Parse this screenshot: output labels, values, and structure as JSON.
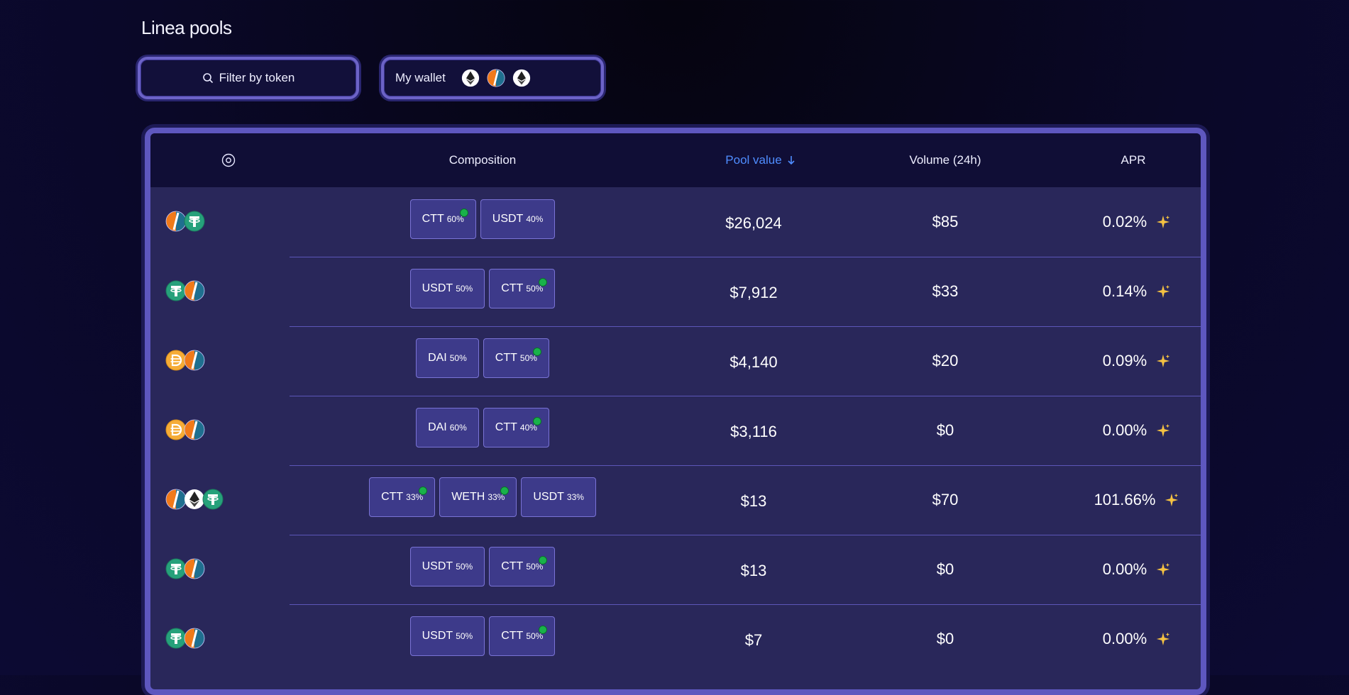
{
  "page": {
    "title": "Linea pools"
  },
  "controls": {
    "filter_label": "Filter by token",
    "wallet_label": "My wallet",
    "wallet_tokens": [
      "eth-icon",
      "ctt-icon",
      "eth-icon"
    ]
  },
  "table": {
    "columns": {
      "composition": "Composition",
      "pool_value": "Pool value",
      "volume": "Volume (24h)",
      "apr": "APR"
    },
    "rows": [
      {
        "icons": [
          "ctt",
          "usdt"
        ],
        "chips": [
          {
            "sym": "CTT",
            "pct": "60%",
            "dot": true
          },
          {
            "sym": "USDT",
            "pct": "40%",
            "dot": false
          }
        ],
        "value": "$26,024",
        "volume": "$85",
        "apr": "0.02%"
      },
      {
        "icons": [
          "usdt",
          "ctt"
        ],
        "chips": [
          {
            "sym": "USDT",
            "pct": "50%",
            "dot": false
          },
          {
            "sym": "CTT",
            "pct": "50%",
            "dot": true
          }
        ],
        "value": "$7,912",
        "volume": "$33",
        "apr": "0.14%"
      },
      {
        "icons": [
          "dai",
          "ctt"
        ],
        "chips": [
          {
            "sym": "DAI",
            "pct": "50%",
            "dot": false
          },
          {
            "sym": "CTT",
            "pct": "50%",
            "dot": true
          }
        ],
        "value": "$4,140",
        "volume": "$20",
        "apr": "0.09%"
      },
      {
        "icons": [
          "dai",
          "ctt"
        ],
        "chips": [
          {
            "sym": "DAI",
            "pct": "60%",
            "dot": false
          },
          {
            "sym": "CTT",
            "pct": "40%",
            "dot": true
          }
        ],
        "value": "$3,116",
        "volume": "$0",
        "apr": "0.00%"
      },
      {
        "icons": [
          "ctt",
          "eth",
          "usdt"
        ],
        "chips": [
          {
            "sym": "CTT",
            "pct": "33%",
            "dot": true
          },
          {
            "sym": "WETH",
            "pct": "33%",
            "dot": true
          },
          {
            "sym": "USDT",
            "pct": "33%",
            "dot": false
          }
        ],
        "value": "$13",
        "volume": "$70",
        "apr": "101.66%"
      },
      {
        "icons": [
          "usdt",
          "ctt"
        ],
        "chips": [
          {
            "sym": "USDT",
            "pct": "50%",
            "dot": false
          },
          {
            "sym": "CTT",
            "pct": "50%",
            "dot": true
          }
        ],
        "value": "$13",
        "volume": "$0",
        "apr": "0.00%"
      },
      {
        "icons": [
          "usdt",
          "ctt"
        ],
        "chips": [
          {
            "sym": "USDT",
            "pct": "50%",
            "dot": false
          },
          {
            "sym": "CTT",
            "pct": "50%",
            "dot": true
          }
        ],
        "value": "$7",
        "volume": "$0",
        "apr": "0.00%"
      }
    ]
  },
  "colors": {
    "accent": "#4f8dff",
    "chip_bg": "#3d3a8a",
    "dot_green": "#19b24a",
    "spark": "#f5c242"
  }
}
